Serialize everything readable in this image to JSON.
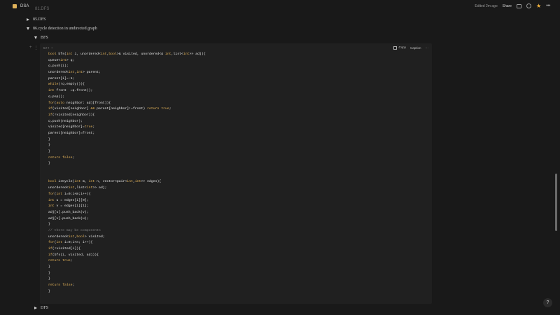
{
  "topbar": {
    "page_title": "DSA",
    "edited": "Edited 2m ago",
    "share": "Share"
  },
  "toggles": {
    "prev_fragment": "81.DFS",
    "t85": "85.DFS",
    "t86": "86.cycle detection in undirected graph",
    "bfs": "BFS",
    "dfs": "DFS"
  },
  "gutter": {
    "plus": "+",
    "drag": "⋮⋮"
  },
  "code": {
    "language": "C++",
    "copy_label": "Copy",
    "caption_label": "Caption",
    "more_label": "···",
    "lines": [
      [
        {
          "t": "bool ",
          "c": "kw"
        },
        {
          "t": "bfs(",
          "c": ""
        },
        {
          "t": "int",
          "c": "kw"
        },
        {
          "t": " i, unordered<",
          "c": ""
        },
        {
          "t": "int",
          "c": "kw"
        },
        {
          "t": ",",
          "c": ""
        },
        {
          "t": "bool",
          "c": "kw"
        },
        {
          "t": ">& visited, unordered<& ",
          "c": ""
        },
        {
          "t": "int",
          "c": "kw"
        },
        {
          "t": ",list<",
          "c": ""
        },
        {
          "t": "int",
          "c": "kw"
        },
        {
          "t": ">> adj){",
          "c": ""
        }
      ],
      [
        {
          "t": "queue<",
          "c": ""
        },
        {
          "t": "int",
          "c": "kw"
        },
        {
          "t": "> q;",
          "c": ""
        }
      ],
      [
        {
          "t": "q.push(i);",
          "c": ""
        }
      ],
      [
        {
          "t": "unordered<",
          "c": ""
        },
        {
          "t": "int",
          "c": "kw"
        },
        {
          "t": ",",
          "c": ""
        },
        {
          "t": "int",
          "c": "kw"
        },
        {
          "t": "> parent;",
          "c": ""
        }
      ],
      [
        {
          "t": "parent[i]=-1;",
          "c": ""
        }
      ],
      [
        {
          "t": "while",
          "c": "kw"
        },
        {
          "t": "(!q.empty()){",
          "c": ""
        }
      ],
      [
        {
          "t": "int",
          "c": "kw"
        },
        {
          "t": " front  =q.front();",
          "c": ""
        }
      ],
      [
        {
          "t": "q.pop();",
          "c": ""
        }
      ],
      [
        {
          "t": "for",
          "c": "kw"
        },
        {
          "t": "(",
          "c": ""
        },
        {
          "t": "auto",
          "c": "kw"
        },
        {
          "t": " neighbor: adj[front]){",
          "c": ""
        }
      ],
      [
        {
          "t": "if",
          "c": "kw"
        },
        {
          "t": "(visited[neighbor] ",
          "c": ""
        },
        {
          "t": "&&",
          "c": "kw"
        },
        {
          "t": " parent[neighbor]!=front) ",
          "c": ""
        },
        {
          "t": "return true",
          "c": "kw"
        },
        {
          "t": ";",
          "c": ""
        }
      ],
      [
        {
          "t": "if",
          "c": "kw"
        },
        {
          "t": "(!visited[neighbor]){",
          "c": ""
        }
      ],
      [
        {
          "t": "q.push(neighbor);",
          "c": ""
        }
      ],
      [
        {
          "t": "visited[neighbor]=",
          "c": ""
        },
        {
          "t": "true",
          "c": "kw"
        },
        {
          "t": ";",
          "c": ""
        }
      ],
      [
        {
          "t": "parent[neighbor]=front;",
          "c": ""
        }
      ],
      [
        {
          "t": "}",
          "c": ""
        }
      ],
      [
        {
          "t": "}",
          "c": ""
        }
      ],
      [
        {
          "t": "}",
          "c": ""
        }
      ],
      [
        {
          "t": "return false",
          "c": "kw"
        },
        {
          "t": ";",
          "c": ""
        }
      ],
      [
        {
          "t": "}",
          "c": ""
        }
      ],
      [],
      [],
      [
        {
          "t": "bool ",
          "c": "kw"
        },
        {
          "t": "isCycle(",
          "c": ""
        },
        {
          "t": "int",
          "c": "kw"
        },
        {
          "t": " m, ",
          "c": ""
        },
        {
          "t": "int",
          "c": "kw"
        },
        {
          "t": " n, vector<pair<",
          "c": ""
        },
        {
          "t": "int",
          "c": "kw"
        },
        {
          "t": ",",
          "c": ""
        },
        {
          "t": "int",
          "c": "kw"
        },
        {
          "t": ">> edges){",
          "c": ""
        }
      ],
      [
        {
          "t": "unordered<",
          "c": ""
        },
        {
          "t": "int",
          "c": "kw"
        },
        {
          "t": ",list<",
          "c": ""
        },
        {
          "t": "int",
          "c": "kw"
        },
        {
          "t": ">> adj;",
          "c": ""
        }
      ],
      [
        {
          "t": "for",
          "c": "kw"
        },
        {
          "t": "(",
          "c": ""
        },
        {
          "t": "int",
          "c": "kw"
        },
        {
          "t": " i=0;i<m;i++){",
          "c": ""
        }
      ],
      [
        {
          "t": "int",
          "c": "kw"
        },
        {
          "t": " u = edges[i][0];",
          "c": ""
        }
      ],
      [
        {
          "t": "int",
          "c": "kw"
        },
        {
          "t": " v = edges[i][1];",
          "c": ""
        }
      ],
      [
        {
          "t": "adj[u].push_back(v);",
          "c": ""
        }
      ],
      [
        {
          "t": "adj[v].push_back(u);",
          "c": ""
        }
      ],
      [
        {
          "t": "}",
          "c": ""
        }
      ],
      [
        {
          "t": "// there may be components",
          "c": "cm"
        }
      ],
      [
        {
          "t": "unordered<",
          "c": ""
        },
        {
          "t": "int",
          "c": "kw"
        },
        {
          "t": ",",
          "c": ""
        },
        {
          "t": "bool",
          "c": "kw"
        },
        {
          "t": "> visited;",
          "c": ""
        }
      ],
      [
        {
          "t": "for",
          "c": "kw"
        },
        {
          "t": "(",
          "c": ""
        },
        {
          "t": "int",
          "c": "kw"
        },
        {
          "t": " i=0;i<n; i++){",
          "c": ""
        }
      ],
      [
        {
          "t": "if",
          "c": "kw"
        },
        {
          "t": "(!visited[i]){",
          "c": ""
        }
      ],
      [
        {
          "t": "if",
          "c": "kw"
        },
        {
          "t": "(bfs(i, visited, adj)){",
          "c": ""
        }
      ],
      [
        {
          "t": "return true",
          "c": "kw"
        },
        {
          "t": ";",
          "c": ""
        }
      ],
      [
        {
          "t": "}",
          "c": ""
        }
      ],
      [
        {
          "t": "}",
          "c": ""
        }
      ],
      [
        {
          "t": "}",
          "c": ""
        }
      ],
      [
        {
          "t": "return false",
          "c": "kw"
        },
        {
          "t": ";",
          "c": ""
        }
      ],
      [
        {
          "t": "}",
          "c": ""
        }
      ]
    ]
  },
  "help": {
    "label": "?"
  }
}
